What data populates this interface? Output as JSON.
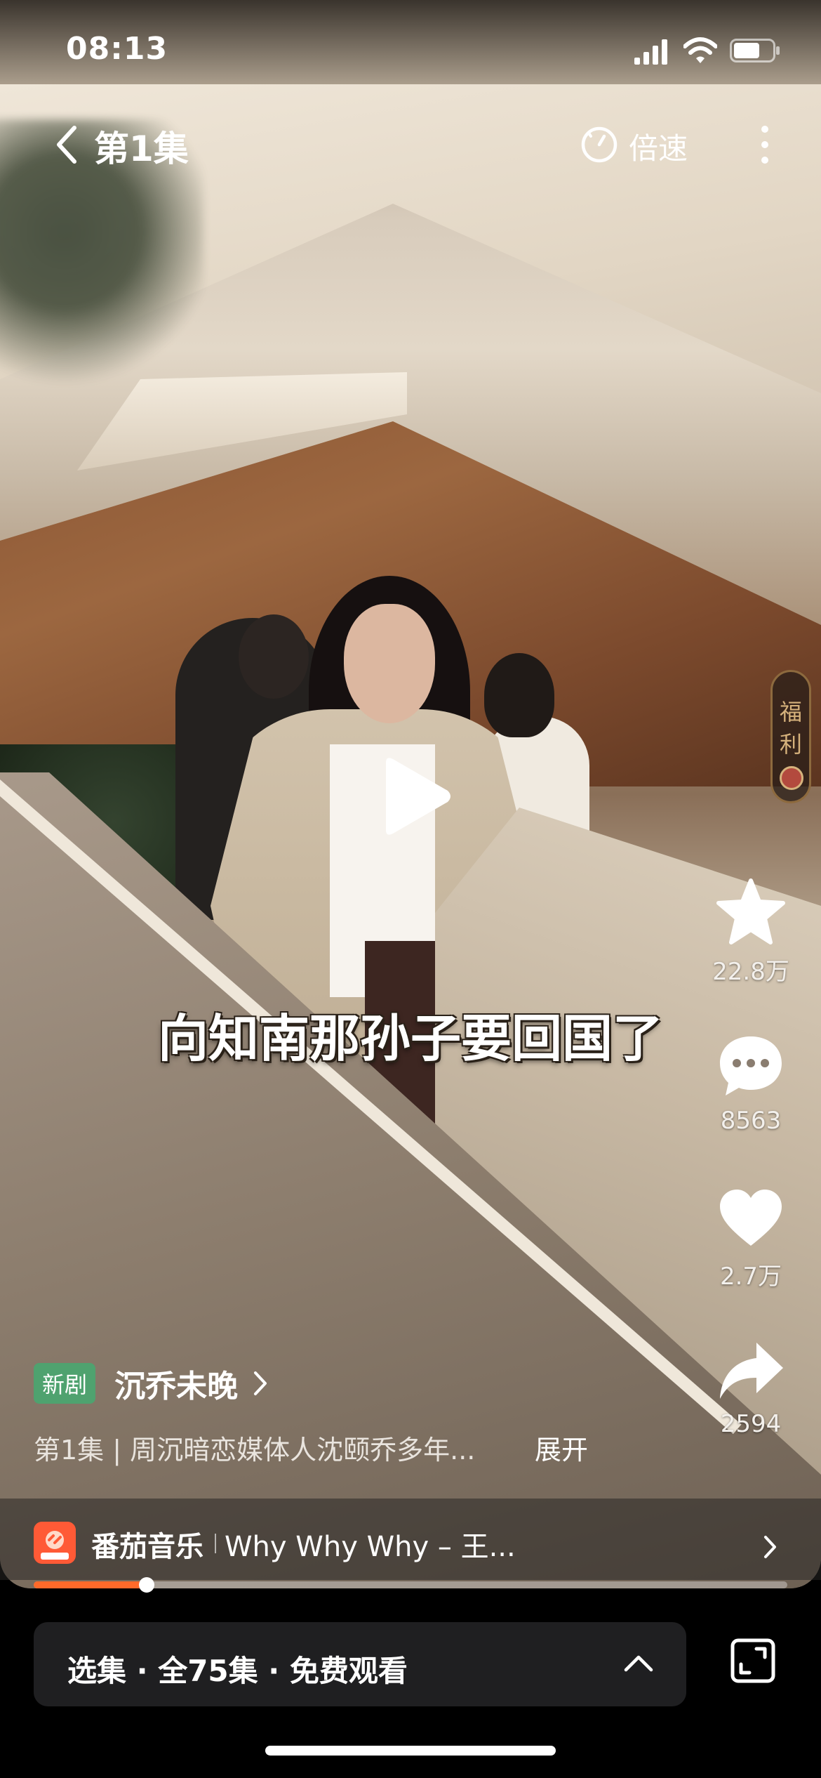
{
  "status_bar": {
    "time": "08:13"
  },
  "top_nav": {
    "episode_title": "第1集",
    "speed_label": "倍速"
  },
  "video": {
    "subtitle": "向知南那孙子要回国了"
  },
  "welfare": {
    "label": "福利"
  },
  "actions": {
    "collect_count": "22.8万",
    "comment_count": "8563",
    "like_count": "2.7万",
    "share_count": "2594"
  },
  "drama": {
    "badge": "新剧",
    "title": "沉乔未晚",
    "description": "第1集 | 周沉暗恋媒体人沈颐乔多年...",
    "expand_label": "展开"
  },
  "music": {
    "app_name": "番茄音乐",
    "track": "Why Why Why – 王..."
  },
  "playback": {
    "progress_percent": 15
  },
  "bottom_bar": {
    "episode_selector_label": "选集 · 全75集 · 免费观看"
  },
  "colors": {
    "accent": "#ff6a2a",
    "badge_green": "#4fa26f",
    "welfare_gold": "#d6b27c"
  }
}
